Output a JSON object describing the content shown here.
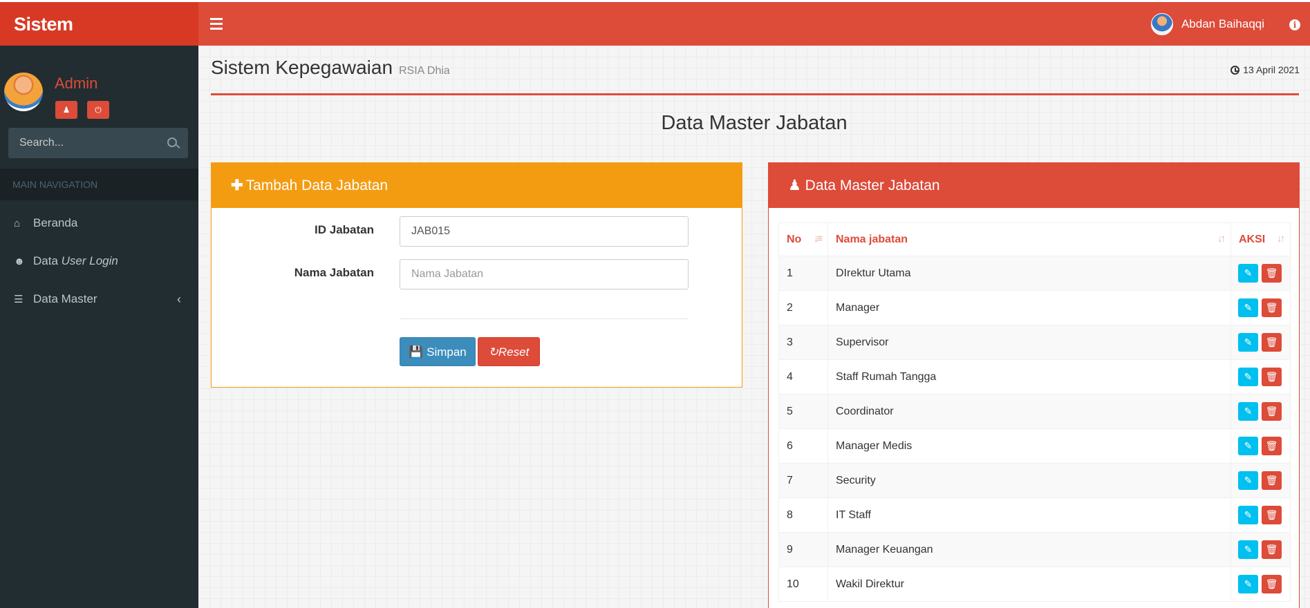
{
  "app": {
    "brand": "Sistem Kepegawaian",
    "user_name": "Abdan Baihaqqi"
  },
  "sidebar": {
    "user_name": "Admin",
    "search_placeholder": "Search...",
    "nav_header": "MAIN NAVIGATION",
    "items": [
      {
        "label": "Beranda",
        "icon": "home-icon"
      },
      {
        "label": "Data ",
        "label_em": "User Login",
        "icon": "user-secret-icon"
      },
      {
        "label": "Data Master",
        "icon": "list-icon"
      }
    ]
  },
  "page": {
    "title": "Sistem Kepegawaian",
    "subtitle": "RSIA Dhia",
    "date": "13 April 2021",
    "heading": "Data Master Jabatan"
  },
  "form": {
    "title": "Tambah Data Jabatan",
    "id_label": "ID Jabatan",
    "id_value": "JAB015",
    "name_label": "Nama Jabatan",
    "name_placeholder": "Nama Jabatan",
    "save_label": "Simpan",
    "reset_label": "Reset"
  },
  "table": {
    "title": "Data Master Jabatan",
    "headers": [
      "No",
      "Nama jabatan",
      "AKSI"
    ],
    "rows": [
      {
        "no": "1",
        "name": "DIrektur Utama"
      },
      {
        "no": "2",
        "name": "Manager"
      },
      {
        "no": "3",
        "name": "Supervisor"
      },
      {
        "no": "4",
        "name": "Staff Rumah Tangga"
      },
      {
        "no": "5",
        "name": "Coordinator"
      },
      {
        "no": "6",
        "name": "Manager Medis"
      },
      {
        "no": "7",
        "name": "Security"
      },
      {
        "no": "8",
        "name": "IT Staff"
      },
      {
        "no": "9",
        "name": "Manager Keuangan"
      },
      {
        "no": "10",
        "name": "Wakil Direktur"
      }
    ]
  },
  "colors": {
    "primary_red": "#dd4b39",
    "sidebar_dark": "#222d32",
    "orange": "#f39c12",
    "blue": "#3c8dbc",
    "cyan": "#00c0ef"
  }
}
